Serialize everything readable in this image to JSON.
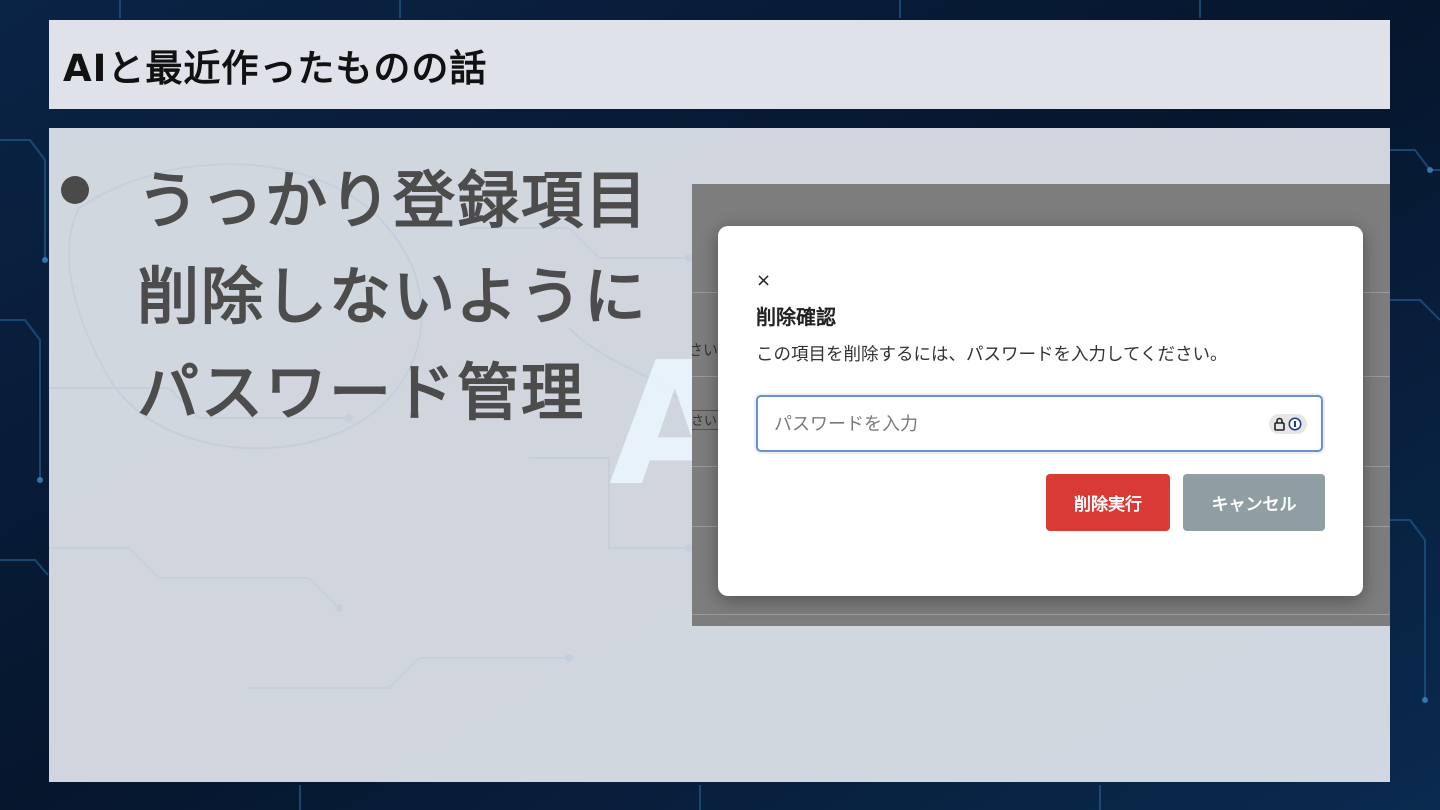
{
  "slide": {
    "title": "AIと最近作ったものの話",
    "bullet_lines": [
      "うっかり登録項目",
      "削除しないように",
      "パスワード管理"
    ]
  },
  "screenshot": {
    "underlay_fragments": [
      "さい",
      "さい"
    ],
    "modal": {
      "close_glyph": "×",
      "heading": "削除確認",
      "message": "この項目を削除するには、パスワードを入力してください。",
      "password_placeholder": "パスワードを入力",
      "delete_label": "削除実行",
      "cancel_label": "キャンセル"
    }
  },
  "icons": {
    "password_manager": "lock-info-icon",
    "bullet": "bullet-dot-icon"
  },
  "colors": {
    "background": "#071a33",
    "delete_button": "#d93a35",
    "cancel_button": "#8f9ea2",
    "field_border": "#6c8fc7"
  }
}
